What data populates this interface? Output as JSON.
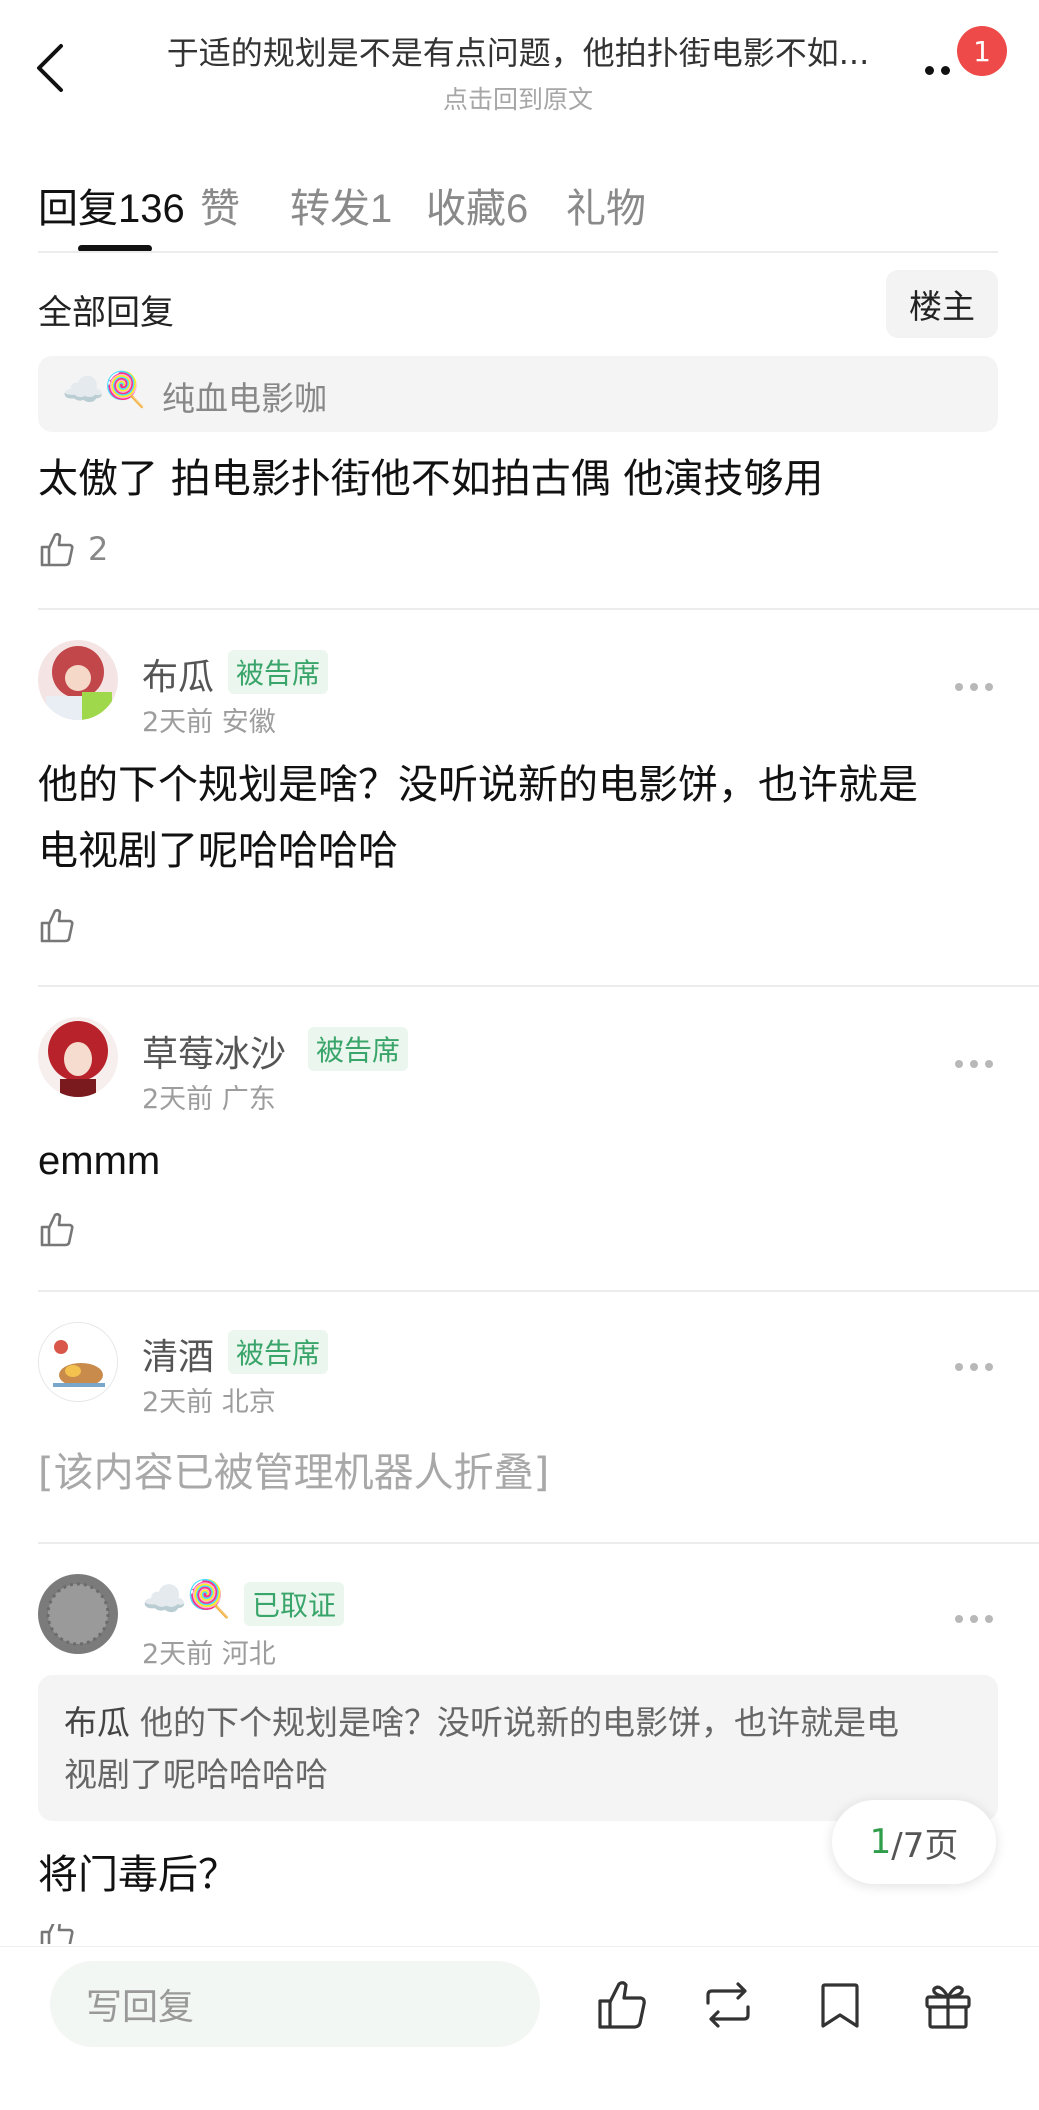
{
  "header": {
    "post_title": "于适的规划是不是有点问题，他拍扑街电影不如...",
    "back_to_post": "点击回到原文",
    "notification_count": "1"
  },
  "tabs": [
    {
      "label": "回复",
      "count": "136"
    },
    {
      "label": "赞",
      "count": ""
    },
    {
      "label": "转发",
      "count": "1"
    },
    {
      "label": "收藏",
      "count": "6"
    },
    {
      "label": "礼物",
      "count": ""
    }
  ],
  "filter": {
    "all_replies": "全部回复",
    "op_only": "楼主"
  },
  "first_reply": {
    "quoted_emoji": "☁️🍭",
    "quoted_name": "纯血电影咖",
    "text": "太傲了 拍电影扑街他不如拍古偶 他演技够用",
    "likes": "2"
  },
  "comments": [
    {
      "name": "布瓜",
      "tag": "被告席",
      "meta": "2天前 安徽",
      "text_line1": "他的下个规划是啥？没听说新的电影饼，也许就是",
      "text_line2": "电视剧了呢哈哈哈哈"
    },
    {
      "name": "草莓冰沙",
      "tag": "被告席",
      "meta": "2天前 广东",
      "text": "emmm"
    },
    {
      "name": "清酒",
      "tag": "被告席",
      "meta": "2天前 北京",
      "text": "[该内容已被管理机器人折叠]"
    },
    {
      "name": "☁️🍭",
      "tag": "已取证",
      "meta": "2天前 河北",
      "quote_user": "布瓜",
      "quote_line1": "他的下个规划是啥？没听说新的电影饼，也许就是电",
      "quote_line2": "视剧了呢哈哈哈哈",
      "text": "将门毒后？"
    }
  ],
  "pager": {
    "current": "1",
    "total": "/7页"
  },
  "bottom_bar": {
    "write_reply_placeholder": "写回复"
  },
  "colors": {
    "tag_green": "#3aa56a",
    "tag_bg": "#eaf6ee",
    "badge_red": "#ef4a4a",
    "pager_green": "#2f9e4b"
  }
}
